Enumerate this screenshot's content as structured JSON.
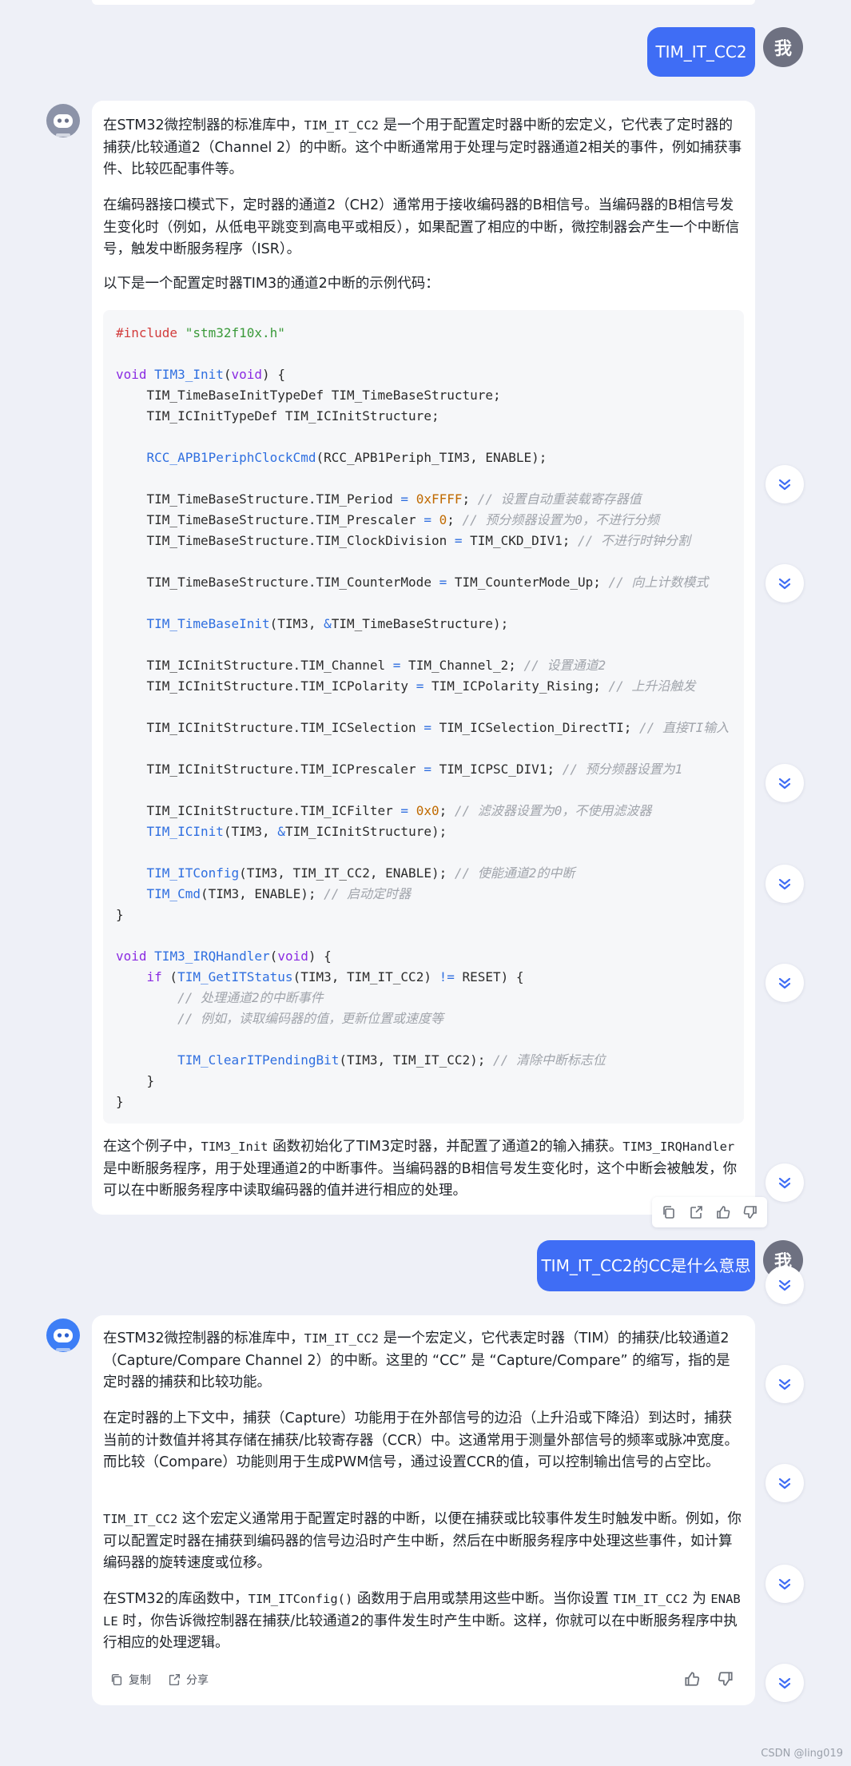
{
  "conversation": {
    "user_avatar_label": "我",
    "msg1": {
      "user_text": "TIM_IT_CC2",
      "p1": {
        "a": "在STM32微控制器的标准库中，",
        "code": "TIM_IT_CC2",
        "b": " 是一个用于配置定时器中断的宏定义，它代表了定时器的捕获/比较通道2（Channel 2）的中断。这个中断通常用于处理与定时器通道2相关的事件，例如捕获事件、比较匹配事件等。"
      },
      "p2": "在编码器接口模式下，定时器的通道2（CH2）通常用于接收编码器的B相信号。当编码器的B相信号发生变化时（例如，从低电平跳变到高电平或相反），如果配置了相应的中断，微控制器会产生一个中断信号，触发中断服务程序（ISR）。",
      "p3": "以下是一个配置定时器TIM3的通道2中断的示例代码：",
      "code": {
        "l1a": "#include",
        "l1b": " \"stm32f10x.h\"",
        "l2a": "void",
        "l2b": "TIM3_Init",
        "l2c": "void",
        "l2d": ") {",
        "l3": "    TIM_TimeBaseInitTypeDef TIM_TimeBaseStructure;",
        "l4": "    TIM_ICInitTypeDef TIM_ICInitStructure;",
        "l5a": "RCC_APB1PeriphClockCmd",
        "l5b": "(RCC_APB1Periph_TIM3, ENABLE);",
        "l6a": "    TIM_TimeBaseStructure.TIM_Period ",
        "l6b": "0xFFFF",
        "l6c": "; ",
        "l6d": "// 设置自动重装载寄存器值",
        "l7a": "    TIM_TimeBaseStructure.TIM_Prescaler ",
        "l7b": "0",
        "l7c": "; ",
        "l7d": "// 预分频器设置为0，不进行分频",
        "l8a": "    TIM_TimeBaseStructure.TIM_ClockDivision ",
        "l8b": " TIM_CKD_DIV1; ",
        "l8c": "// 不进行时钟分割",
        "l9a": "    TIM_TimeBaseStructure.TIM_CounterMode ",
        "l9b": " TIM_CounterMode_Up; ",
        "l9c": "// 向上计数模式",
        "l10a": "TIM_TimeBaseInit",
        "l10b": "(TIM3, ",
        "l10c": "TIM_TimeBaseStructure);",
        "l11a": "    TIM_ICInitStructure.TIM_Channel ",
        "l11b": " TIM_Channel_2; ",
        "l11c": "// 设置通道2",
        "l12a": "    TIM_ICInitStructure.TIM_ICPolarity ",
        "l12b": " TIM_ICPolarity_Rising; ",
        "l12c": "// 上升沿触发",
        "l13a": "    TIM_ICInitStructure.TIM_ICSelection ",
        "l13b": " TIM_ICSelection_DirectTI; ",
        "l13c": "// 直接TI输入",
        "l14a": "    TIM_ICInitStructure.TIM_ICPrescaler ",
        "l14b": " TIM_ICPSC_DIV1; ",
        "l14c": "// 预分频器设置为1",
        "l15a": "    TIM_ICInitStructure.TIM_ICFilter ",
        "l15b": "0x0",
        "l15c": "; ",
        "l15d": "// 滤波器设置为0，不使用滤波器",
        "l16a": "TIM_ICInit",
        "l16b": "(TIM3, ",
        "l16c": "TIM_ICInitStructure);",
        "l17a": "TIM_ITConfig",
        "l17b": "(TIM3, TIM_IT_CC2, ENABLE); ",
        "l17c": "// 使能通道2的中断",
        "l18a": "TIM_Cmd",
        "l18b": "(TIM3, ENABLE); ",
        "l18c": "// 启动定时器",
        "l19": "}",
        "l20a": "void",
        "l20b": "TIM3_IRQHandler",
        "l20c": "void",
        "l20d": ") {",
        "l21a": "if",
        "l21b": "TIM_GetITStatus",
        "l21c": "(TIM3, TIM_IT_CC2) ",
        "l21d": "!=",
        "l21e": " RESET) {",
        "l22": "        // 处理通道2的中断事件",
        "l23": "        // 例如，读取编码器的值，更新位置或速度等",
        "l24a": "TIM_ClearITPendingBit",
        "l24b": "(TIM3, TIM_IT_CC2); ",
        "l24c": "// 清除中断标志位",
        "l25": "    }",
        "l26": "}"
      },
      "p4": {
        "a": "在这个例子中，",
        "c1": "TIM3_Init",
        "b": " 函数初始化了TIM3定时器，并配置了通道2的输入捕获。",
        "c2": "TIM3_IRQHandler",
        "c": " 是中断服务程序，用于处理通道2的中断事件。当编码器的B相信号发生变化时，这个中断会被触发，你可以在中断服务程序中读取编码器的值并进行相应的处理。"
      }
    },
    "msg2": {
      "user_text": "TIM_IT_CC2的CC是什么意思",
      "p1": {
        "a": "在STM32微控制器的标准库中，",
        "code": "TIM_IT_CC2",
        "b": " 是一个宏定义，它代表定时器（TIM）的捕获/比较通道2（Capture/Compare Channel 2）的中断。这里的 “CC” 是 “Capture/Compare” 的缩写，指的是定时器的捕获和比较功能。"
      },
      "p2": "在定时器的上下文中，捕获（Capture）功能用于在外部信号的边沿（上升沿或下降沿）到达时，捕获当前的计数值并将其存储在捕获/比较寄存器（CCR）中。这通常用于测量外部信号的频率或脉冲宽度。而比较（Compare）功能则用于生成PWM信号，通过设置CCR的值，可以控制输出信号的占空比。",
      "p3": {
        "code": "TIM_IT_CC2",
        "b": " 这个宏定义通常用于配置定时器的中断，以便在捕获或比较事件发生时触发中断。例如，你可以配置定时器在捕获到编码器的信号边沿时产生中断，然后在中断服务程序中处理这些事件，如计算编码器的旋转速度或位移。"
      },
      "p4": {
        "a": "在STM32的库函数中，",
        "c1": "TIM_ITConfig()",
        "b": " 函数用于启用或禁用这些中断。当你设置 ",
        "c2": "TIM_IT_CC2",
        "c": " 为 ",
        "c3": "ENABLE",
        "d": " 时，你告诉微控制器在捕获/比较通道2的事件发生时产生中断。这样，你就可以在中断服务程序中执行相应的处理逻辑。"
      },
      "copy_label": "复制",
      "share_label": "分享"
    }
  },
  "watermark": "CSDN @ling019",
  "icons": [
    "chevron-down-icon",
    "copy-icon",
    "share-icon",
    "thumbs-up-icon",
    "thumbs-down-icon",
    "robot-avatar-icon"
  ],
  "colors": {
    "user_bubble": "#3f6df5",
    "background": "#eef0f7",
    "chevron": "#3f6df5"
  }
}
